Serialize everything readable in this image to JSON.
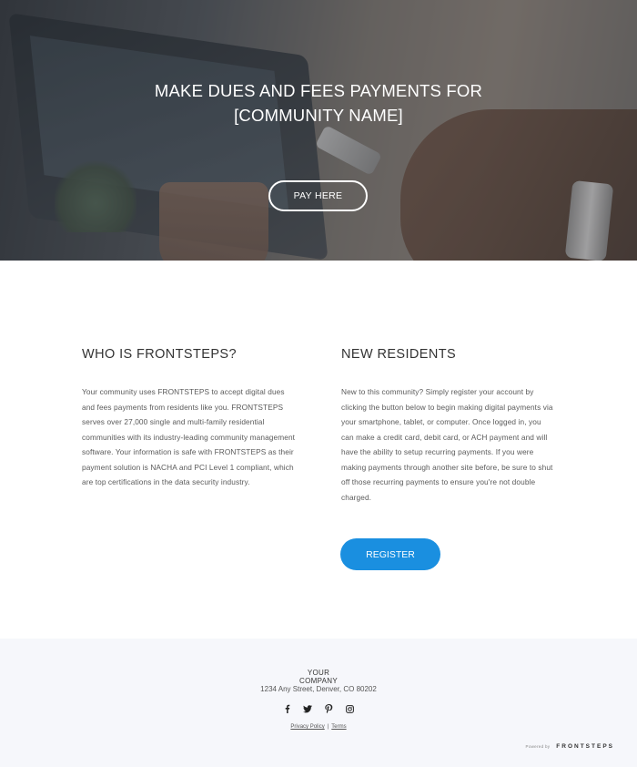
{
  "hero": {
    "title_line1": "MAKE DUES AND FEES PAYMENTS FOR",
    "title_line2": "[COMMUNITY NAME]",
    "pay_button": "PAY HERE"
  },
  "about": {
    "heading": "WHO IS FRONTSTEPS?",
    "body": "Your community uses FRONTSTEPS to accept digital dues and fees payments from residents like you. FRONTSTEPS serves over 27,000 single and multi-family residential communities with its industry-leading community management software. Your information is safe with FRONTSTEPS as their payment solution is NACHA and PCI Level 1 compliant, which are top certifications in the data security industry."
  },
  "residents": {
    "heading": "NEW RESIDENTS",
    "body": "New to this community? Simply register your account by clicking the button below to begin making digital payments via your smartphone, tablet, or computer. Once logged in, you can make a credit card, debit card, or ACH payment and will have the ability to setup recurring payments. If you were making payments through another site before, be sure to shut off those recurring payments to ensure you're not double charged.",
    "register_button": "REGISTER"
  },
  "footer": {
    "company_line1": "YOUR",
    "company_line2": "COMPANY",
    "address": "1234 Any Street, Denver, CO 80202",
    "socials": [
      "facebook-icon",
      "twitter-icon",
      "pinterest-icon",
      "instagram-icon"
    ],
    "privacy_link": "Privacy Policy",
    "separator": "|",
    "terms_link": "Terms",
    "powered_by": "Powered by",
    "brand": "FRONTSTEPS"
  },
  "colors": {
    "accent": "#1a8fe0",
    "footer_bg": "#f6f7fb",
    "heading": "#333333"
  }
}
